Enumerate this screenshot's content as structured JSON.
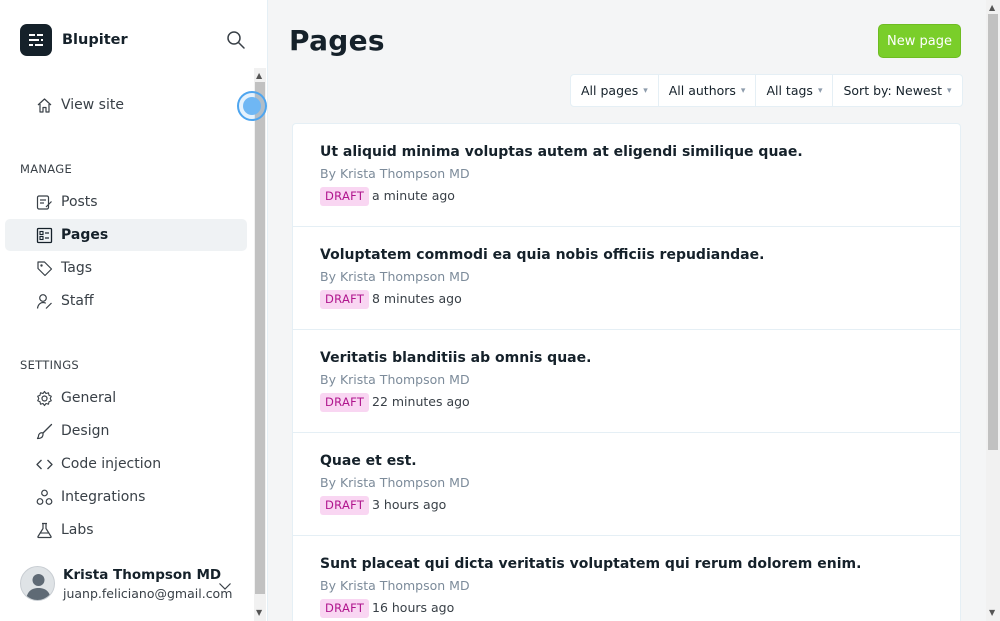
{
  "brand": {
    "name": "Blupiter",
    "icon": "ghost-logo-icon"
  },
  "sidebar": {
    "view_site": "View site",
    "manage_title": "MANAGE",
    "manage_items": [
      {
        "label": "Posts",
        "icon": "posts-icon"
      },
      {
        "label": "Pages",
        "icon": "pages-icon",
        "active": true
      },
      {
        "label": "Tags",
        "icon": "tag-icon"
      },
      {
        "label": "Staff",
        "icon": "staff-icon"
      }
    ],
    "settings_title": "SETTINGS",
    "settings_items": [
      {
        "label": "General",
        "icon": "gear-icon"
      },
      {
        "label": "Design",
        "icon": "brush-icon"
      },
      {
        "label": "Code injection",
        "icon": "code-icon"
      },
      {
        "label": "Integrations",
        "icon": "integrations-icon"
      },
      {
        "label": "Labs",
        "icon": "flask-icon"
      }
    ],
    "user": {
      "name": "Krista Thompson MD",
      "email": "juanp.feliciano@gmail.com"
    }
  },
  "main": {
    "title": "Pages",
    "new_button": "New page",
    "filters": {
      "type": "All pages",
      "authors": "All authors",
      "tags": "All tags",
      "sort": "Sort by: Newest"
    },
    "pages": [
      {
        "title": "Ut aliquid minima voluptas autem at eligendi similique quae.",
        "author": "By Krista Thompson MD",
        "status": "DRAFT",
        "time": "a minute ago"
      },
      {
        "title": "Voluptatem commodi ea quia nobis officiis repudiandae.",
        "author": "By Krista Thompson MD",
        "status": "DRAFT",
        "time": "8 minutes ago"
      },
      {
        "title": "Veritatis blanditiis ab omnis quae.",
        "author": "By Krista Thompson MD",
        "status": "DRAFT",
        "time": "22 minutes ago"
      },
      {
        "title": "Quae et est.",
        "author": "By Krista Thompson MD",
        "status": "DRAFT",
        "time": "3 hours ago"
      },
      {
        "title": "Sunt placeat qui dicta veritatis voluptatem qui rerum dolorem enim.",
        "author": "By Krista Thompson MD",
        "status": "DRAFT",
        "time": "16 hours ago"
      }
    ]
  },
  "colors": {
    "accent": "#7ace2a",
    "draft_bg": "#f9d6f2",
    "draft_text": "#b0158d"
  }
}
